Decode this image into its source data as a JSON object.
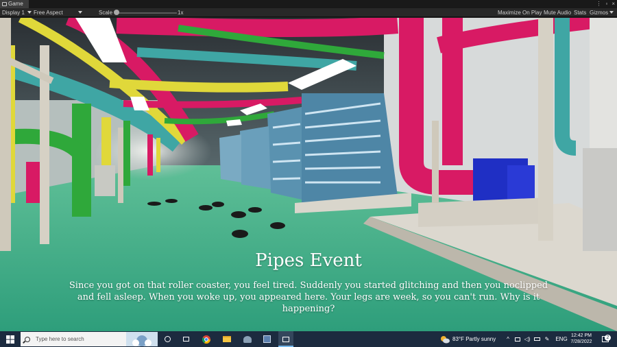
{
  "unity": {
    "tab_title": "Game",
    "display": "Display 1",
    "aspect": "Free Aspect",
    "scale_label": "Scale",
    "scale_value": "1x",
    "maximize": "Maximize On Play",
    "mute": "Mute Audio",
    "stats": "Stats",
    "gizmos": "Gizmos"
  },
  "event": {
    "title": "Pipes Event",
    "body": "Since you got on that roller coaster, you feel tired. Suddenly you started glitching and then you noclipped and fell asleep. When you woke up, you appeared here. Your legs are week, so you can't run. Why is it happening?"
  },
  "taskbar": {
    "search_placeholder": "Type here to search",
    "weather": "83°F  Partly sunny",
    "language": "ENG",
    "time": "12:42 PM",
    "date": "7/28/2022",
    "notification_count": "2",
    "pinned_apps": [
      "task-view-icon",
      "chrome-icon",
      "file-explorer-icon",
      "photos-icon",
      "app-icon",
      "unity-icon"
    ]
  },
  "colors": {
    "pipe_magenta": "#d81a64",
    "pipe_teal": "#3fa6a4",
    "pipe_yellow": "#e0d83a",
    "pipe_green": "#2fa83a",
    "floor_green": "#39a884",
    "taskbar": "#1c2b3f"
  }
}
